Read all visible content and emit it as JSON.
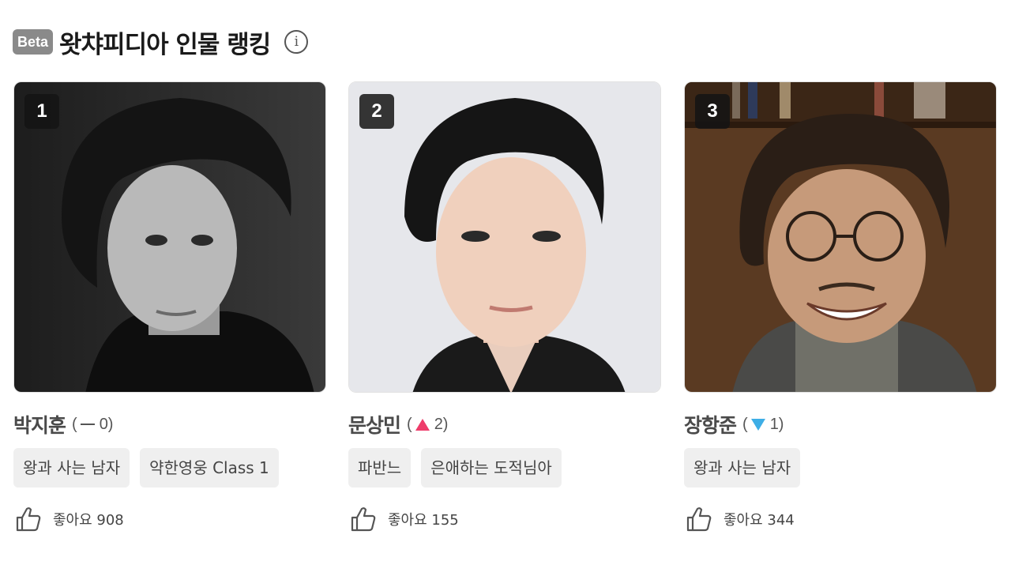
{
  "header": {
    "beta_label": "Beta",
    "title": "왓챠피디아 인물 랭킹",
    "info_icon": "i"
  },
  "cards": [
    {
      "rank": "1",
      "name": "박지훈",
      "change_open": "(",
      "change_value": "0)",
      "change_direction": "same",
      "tags": [
        "왕과 사는 남자",
        "약한영웅 Class 1"
      ],
      "likes": "좋아요 908"
    },
    {
      "rank": "2",
      "name": "문상민",
      "change_open": "(",
      "change_value": "2)",
      "change_direction": "up",
      "tags": [
        "파반느",
        "은애하는 도적님아"
      ],
      "likes": "좋아요 155"
    },
    {
      "rank": "3",
      "name": "장항준",
      "change_open": "(",
      "change_value": "1)",
      "change_direction": "down",
      "tags": [
        "왕과 사는 남자"
      ],
      "likes": "좋아요 344"
    }
  ],
  "colors": {
    "up": "#ee3c6a",
    "down": "#3eaee6",
    "beta_bg": "#8a8a8a",
    "tag_bg": "#efefef"
  },
  "icons": {
    "info": "info-icon",
    "like": "thumbs-up-icon",
    "same": "dash-icon",
    "up": "triangle-up-icon",
    "down": "triangle-down-icon"
  }
}
